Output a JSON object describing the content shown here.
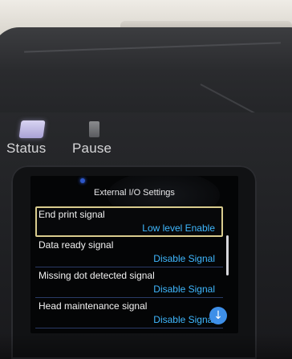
{
  "panel": {
    "status_label": "Status",
    "pause_label": "Pause"
  },
  "screen": {
    "title": "External I/O Settings",
    "items": [
      {
        "name": "End print signal",
        "value": "Low level Enable",
        "selected": true
      },
      {
        "name": "Data ready signal",
        "value": "Disable Signal",
        "selected": false
      },
      {
        "name": "Missing dot detected signal",
        "value": "Disable Signal",
        "selected": false
      },
      {
        "name": "Head maintenance signal",
        "value": "Disable Signal",
        "selected": false
      }
    ],
    "scroll_down_icon": "arrow-down-circle-icon",
    "colors": {
      "value_text": "#3fb8ff",
      "selection_border": "#d9cc8e",
      "scroll_button": "#3e8fe8"
    }
  }
}
